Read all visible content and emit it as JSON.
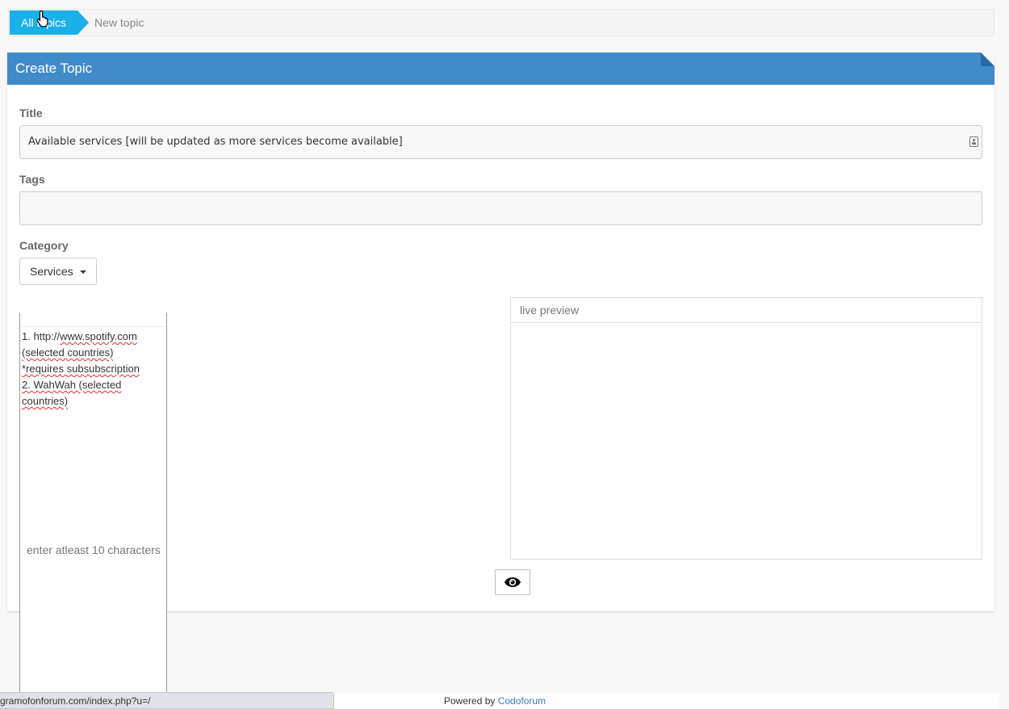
{
  "breadcrumb": {
    "home_label": "All topics",
    "current_label": "New topic"
  },
  "panel": {
    "title": "Create Topic"
  },
  "form": {
    "title_label": "Title",
    "title_value": "Available services [will be updated as more services become available]",
    "tags_label": "Tags",
    "tags_value": "",
    "category_label": "Category",
    "category_selected": "Services"
  },
  "editor": {
    "lines": [
      "1. http://www.spotify.com",
      "(selected countries)",
      "*requires subsubscription",
      "2. WahWah (selected",
      "countries)"
    ],
    "hint": "enter atleast 10 characters"
  },
  "preview": {
    "label": "live preview",
    "toggle_icon": "eye-icon"
  },
  "footer": {
    "powered_by": "Powered by",
    "brand": "Codoforum"
  },
  "status_bar": {
    "url": "gramofonforum.com/index.php?u=/"
  },
  "colors": {
    "breadcrumb_accent": "#1ab0e8",
    "panel_header": "#428bca",
    "link": "#3a7ab7"
  }
}
